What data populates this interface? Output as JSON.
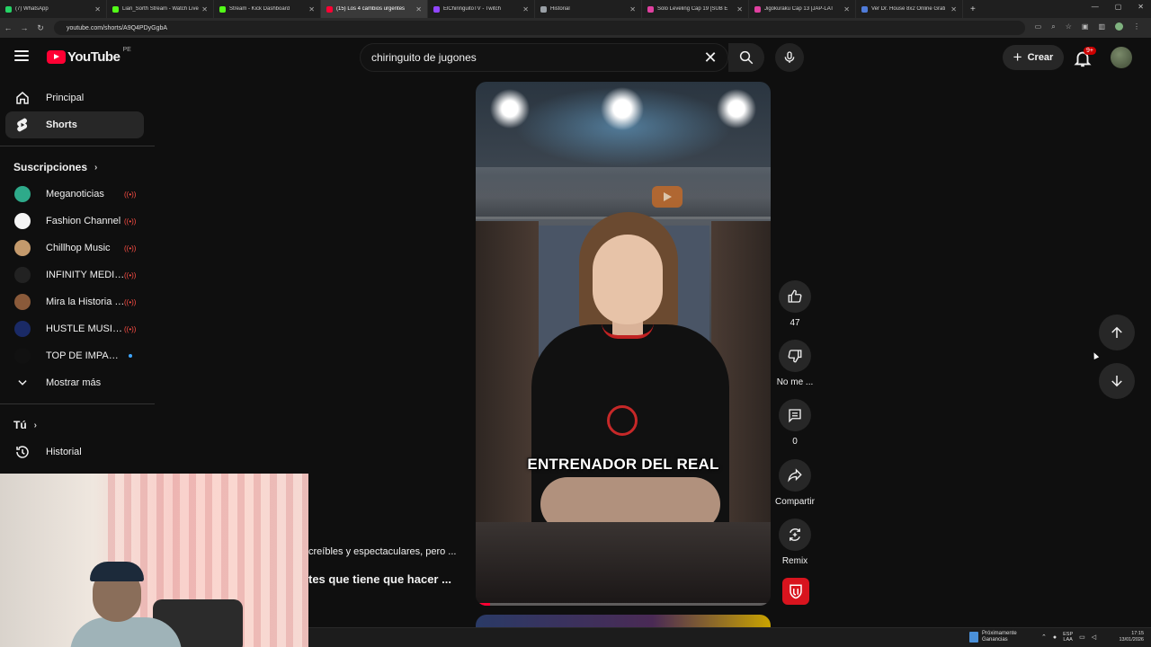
{
  "browser": {
    "tabs": [
      {
        "title": "(7) WhatsApp",
        "color": "#25d366"
      },
      {
        "title": "Lian_Sorth Stream - Watch Live",
        "color": "#53fc18"
      },
      {
        "title": "Stream - Kick Dashboard",
        "color": "#53fc18"
      },
      {
        "title": "(15) Los 4 cambios urgentes",
        "color": "#ff0033",
        "active": true
      },
      {
        "title": "ElChiringuitoTV - Twitch",
        "color": "#9146ff"
      },
      {
        "title": "Historial",
        "color": "#9aa0a6"
      },
      {
        "title": "Solo Leveling Cap 19 [SUB E",
        "color": "#e040a0"
      },
      {
        "title": "Jigokuraku Cap 13 [JAP-LAT",
        "color": "#e040a0"
      },
      {
        "title": "Ver Dr. House 8x2 Online Grati",
        "color": "#4f7bd8"
      }
    ],
    "url": "youtube.com/shorts/A9Q4PDyGgbA"
  },
  "header": {
    "logo_text": "YouTube",
    "country_code": "PE",
    "search_value": "chiringuito de jugones",
    "create_label": "Crear",
    "notif_count": "9+"
  },
  "sidebar": {
    "main": [
      {
        "label": "Principal",
        "icon": "home-icon"
      },
      {
        "label": "Shorts",
        "icon": "shorts-icon",
        "selected": true
      }
    ],
    "subs_heading": "Suscripciones",
    "subscriptions": [
      {
        "label": "Meganoticias",
        "status": "live",
        "color": "#2eaa8a"
      },
      {
        "label": "Fashion Channel",
        "status": "live",
        "color": "#f5f5f5"
      },
      {
        "label": "Chillhop Music",
        "status": "live",
        "color": "#c49a6c"
      },
      {
        "label": "INFINITY MEDIA ...",
        "status": "live",
        "color": "#222222"
      },
      {
        "label": "Mira la Historia /...",
        "status": "live",
        "color": "#8a5a3a"
      },
      {
        "label": "HUSTLE MUSIC (...",
        "status": "live",
        "color": "#1a2a66"
      },
      {
        "label": "TOP DE IMPACTO",
        "status": "new",
        "color": "#111111"
      }
    ],
    "show_more": "Mostrar más",
    "you_heading": "Tú",
    "history": "Historial"
  },
  "short": {
    "caption": "ENTRENADOR DEL REAL",
    "progress": 0.05,
    "description": "creíbles y espectaculares, pero ...",
    "title": "tes que tiene que hacer ..."
  },
  "actions": {
    "likes": "47",
    "dislike_label": "No me ...",
    "comments": "0",
    "share_label": "Compartir",
    "remix_label": "Remix"
  },
  "taskbar": {
    "weather_line1": "Próximamente",
    "weather_line2": "Ganancias",
    "lang1": "ESP",
    "lang2": "LAA",
    "time": "17:15",
    "date": "13/01/2026"
  }
}
